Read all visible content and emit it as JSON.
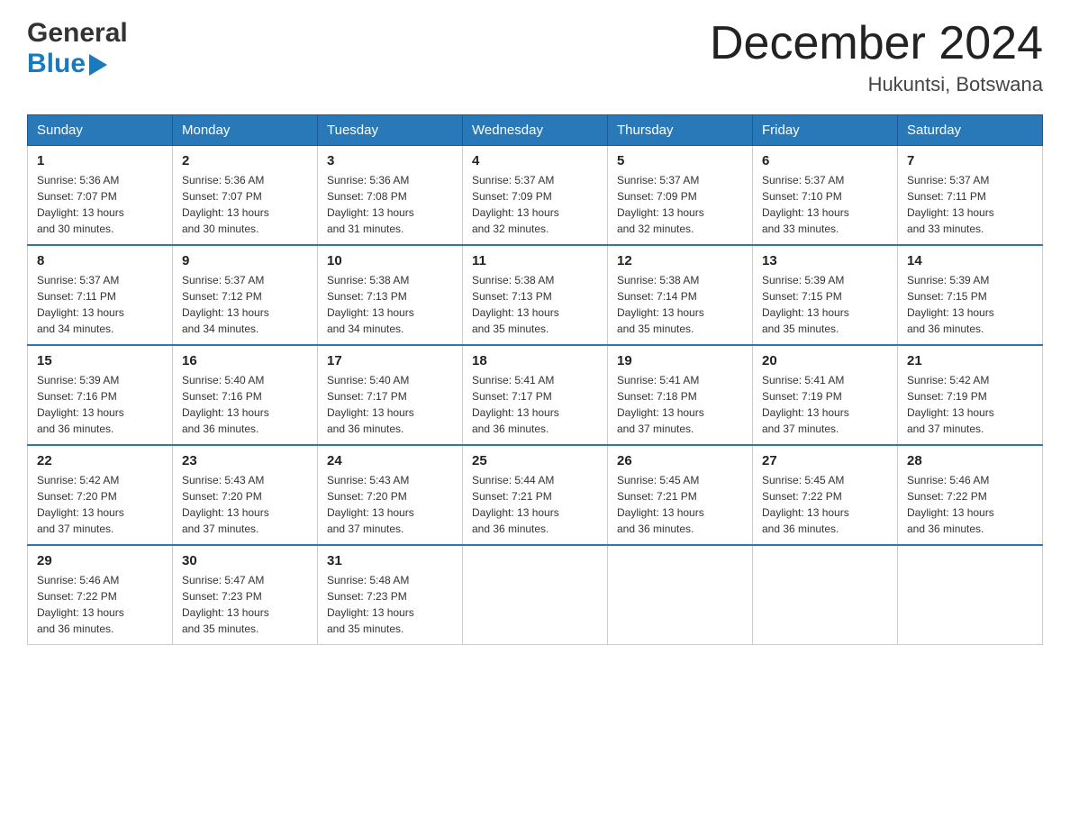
{
  "logo": {
    "general": "General",
    "blue": "Blue"
  },
  "header": {
    "title": "December 2024",
    "subtitle": "Hukuntsi, Botswana"
  },
  "days_of_week": [
    "Sunday",
    "Monday",
    "Tuesday",
    "Wednesday",
    "Thursday",
    "Friday",
    "Saturday"
  ],
  "weeks": [
    [
      {
        "num": "1",
        "sunrise": "5:36 AM",
        "sunset": "7:07 PM",
        "daylight": "13 hours and 30 minutes."
      },
      {
        "num": "2",
        "sunrise": "5:36 AM",
        "sunset": "7:07 PM",
        "daylight": "13 hours and 30 minutes."
      },
      {
        "num": "3",
        "sunrise": "5:36 AM",
        "sunset": "7:08 PM",
        "daylight": "13 hours and 31 minutes."
      },
      {
        "num": "4",
        "sunrise": "5:37 AM",
        "sunset": "7:09 PM",
        "daylight": "13 hours and 32 minutes."
      },
      {
        "num": "5",
        "sunrise": "5:37 AM",
        "sunset": "7:09 PM",
        "daylight": "13 hours and 32 minutes."
      },
      {
        "num": "6",
        "sunrise": "5:37 AM",
        "sunset": "7:10 PM",
        "daylight": "13 hours and 33 minutes."
      },
      {
        "num": "7",
        "sunrise": "5:37 AM",
        "sunset": "7:11 PM",
        "daylight": "13 hours and 33 minutes."
      }
    ],
    [
      {
        "num": "8",
        "sunrise": "5:37 AM",
        "sunset": "7:11 PM",
        "daylight": "13 hours and 34 minutes."
      },
      {
        "num": "9",
        "sunrise": "5:37 AM",
        "sunset": "7:12 PM",
        "daylight": "13 hours and 34 minutes."
      },
      {
        "num": "10",
        "sunrise": "5:38 AM",
        "sunset": "7:13 PM",
        "daylight": "13 hours and 34 minutes."
      },
      {
        "num": "11",
        "sunrise": "5:38 AM",
        "sunset": "7:13 PM",
        "daylight": "13 hours and 35 minutes."
      },
      {
        "num": "12",
        "sunrise": "5:38 AM",
        "sunset": "7:14 PM",
        "daylight": "13 hours and 35 minutes."
      },
      {
        "num": "13",
        "sunrise": "5:39 AM",
        "sunset": "7:15 PM",
        "daylight": "13 hours and 35 minutes."
      },
      {
        "num": "14",
        "sunrise": "5:39 AM",
        "sunset": "7:15 PM",
        "daylight": "13 hours and 36 minutes."
      }
    ],
    [
      {
        "num": "15",
        "sunrise": "5:39 AM",
        "sunset": "7:16 PM",
        "daylight": "13 hours and 36 minutes."
      },
      {
        "num": "16",
        "sunrise": "5:40 AM",
        "sunset": "7:16 PM",
        "daylight": "13 hours and 36 minutes."
      },
      {
        "num": "17",
        "sunrise": "5:40 AM",
        "sunset": "7:17 PM",
        "daylight": "13 hours and 36 minutes."
      },
      {
        "num": "18",
        "sunrise": "5:41 AM",
        "sunset": "7:17 PM",
        "daylight": "13 hours and 36 minutes."
      },
      {
        "num": "19",
        "sunrise": "5:41 AM",
        "sunset": "7:18 PM",
        "daylight": "13 hours and 37 minutes."
      },
      {
        "num": "20",
        "sunrise": "5:41 AM",
        "sunset": "7:19 PM",
        "daylight": "13 hours and 37 minutes."
      },
      {
        "num": "21",
        "sunrise": "5:42 AM",
        "sunset": "7:19 PM",
        "daylight": "13 hours and 37 minutes."
      }
    ],
    [
      {
        "num": "22",
        "sunrise": "5:42 AM",
        "sunset": "7:20 PM",
        "daylight": "13 hours and 37 minutes."
      },
      {
        "num": "23",
        "sunrise": "5:43 AM",
        "sunset": "7:20 PM",
        "daylight": "13 hours and 37 minutes."
      },
      {
        "num": "24",
        "sunrise": "5:43 AM",
        "sunset": "7:20 PM",
        "daylight": "13 hours and 37 minutes."
      },
      {
        "num": "25",
        "sunrise": "5:44 AM",
        "sunset": "7:21 PM",
        "daylight": "13 hours and 36 minutes."
      },
      {
        "num": "26",
        "sunrise": "5:45 AM",
        "sunset": "7:21 PM",
        "daylight": "13 hours and 36 minutes."
      },
      {
        "num": "27",
        "sunrise": "5:45 AM",
        "sunset": "7:22 PM",
        "daylight": "13 hours and 36 minutes."
      },
      {
        "num": "28",
        "sunrise": "5:46 AM",
        "sunset": "7:22 PM",
        "daylight": "13 hours and 36 minutes."
      }
    ],
    [
      {
        "num": "29",
        "sunrise": "5:46 AM",
        "sunset": "7:22 PM",
        "daylight": "13 hours and 36 minutes."
      },
      {
        "num": "30",
        "sunrise": "5:47 AM",
        "sunset": "7:23 PM",
        "daylight": "13 hours and 35 minutes."
      },
      {
        "num": "31",
        "sunrise": "5:48 AM",
        "sunset": "7:23 PM",
        "daylight": "13 hours and 35 minutes."
      },
      null,
      null,
      null,
      null
    ]
  ],
  "labels": {
    "sunrise": "Sunrise:",
    "sunset": "Sunset:",
    "daylight": "Daylight:"
  }
}
